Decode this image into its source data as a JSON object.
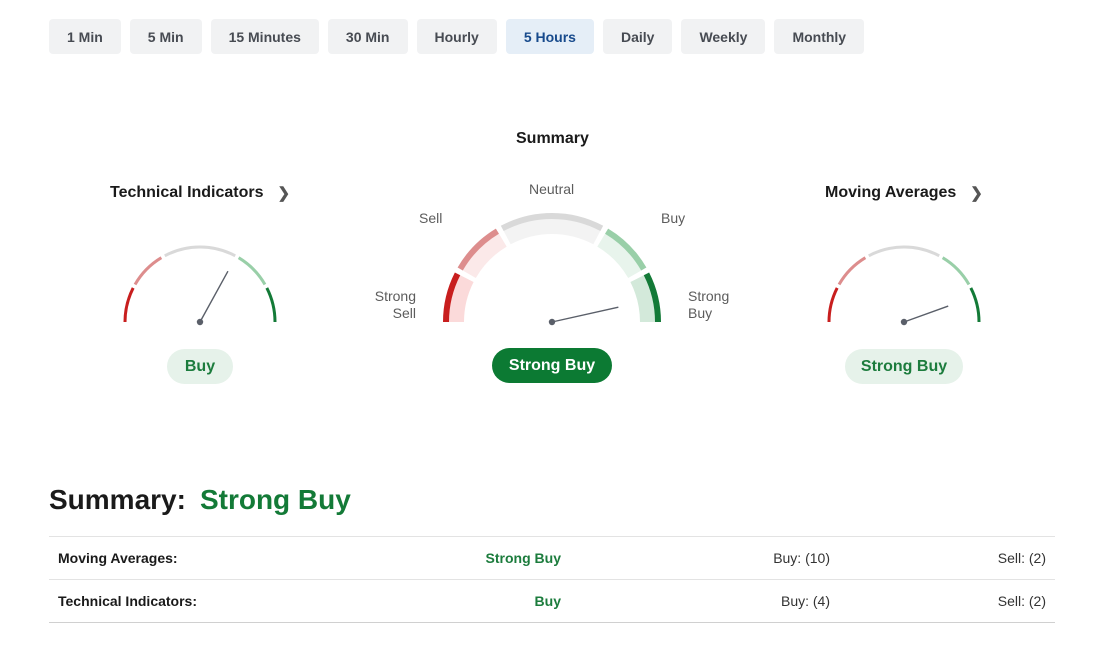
{
  "timeframes": [
    "1 Min",
    "5 Min",
    "15 Minutes",
    "30 Min",
    "Hourly",
    "5 Hours",
    "Daily",
    "Weekly",
    "Monthly"
  ],
  "active_timeframe": "5 Hours",
  "summary_title": "Summary",
  "technical": {
    "title": "Technical Indicators",
    "result": "Buy",
    "needle_level": 0.66
  },
  "summary_gauge": {
    "result": "Strong Buy",
    "needle_level": 0.93,
    "labels": {
      "neutral": "Neutral",
      "sell": "Sell",
      "buy": "Buy",
      "strong_sell": "Strong\nSell",
      "strong_buy": "Strong\nBuy"
    }
  },
  "moving_averages": {
    "title": "Moving Averages",
    "result": "Strong Buy",
    "needle_level": 0.89
  },
  "summary_line": {
    "label": "Summary:",
    "value": "Strong Buy"
  },
  "table": [
    {
      "name": "Moving Averages:",
      "signal": "Strong Buy",
      "buy": "Buy: (10)",
      "sell": "Sell: (2)"
    },
    {
      "name": "Technical Indicators:",
      "signal": "Buy",
      "buy": "Buy: (4)",
      "sell": "Sell: (2)"
    }
  ],
  "colors": {
    "strong_sell": "#c81e1e",
    "sell": "#dd8d8d",
    "neutral": "#d9d9d9",
    "buy": "#99cfa8",
    "strong_buy": "#137a37",
    "accent": "#174a8c"
  }
}
